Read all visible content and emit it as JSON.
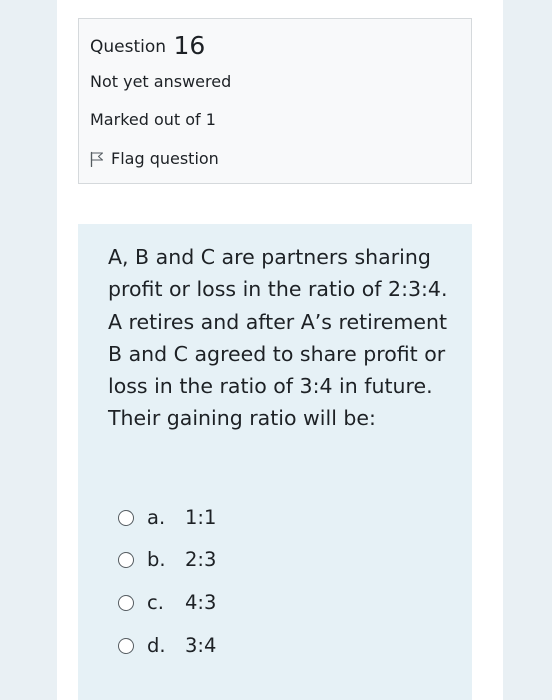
{
  "question_info": {
    "title_prefix": "Question",
    "number": "16",
    "state": "Not yet answered",
    "grade": "Marked out of 1",
    "flag_label": "Flag question"
  },
  "question": {
    "text": "A, B and C are partners sharing profit or loss in the ratio of 2:3:4. A retires and after A’s retirement B and C agreed to share profit or loss in the ratio of 3:4 in future. Their gaining ratio will be:",
    "options": [
      {
        "letter": "a.",
        "text": "1:1"
      },
      {
        "letter": "b.",
        "text": "2:3"
      },
      {
        "letter": "c.",
        "text": "4:3"
      },
      {
        "letter": "d.",
        "text": "3:4"
      }
    ]
  },
  "colors": {
    "page_side": "#e9f0f4",
    "info_background": "#f8f9fa",
    "content_background": "#e6f1f6",
    "text": "#1d2125"
  },
  "icons": {
    "flag": "flag-outline-icon",
    "radio": "radio-unchecked-icon"
  }
}
